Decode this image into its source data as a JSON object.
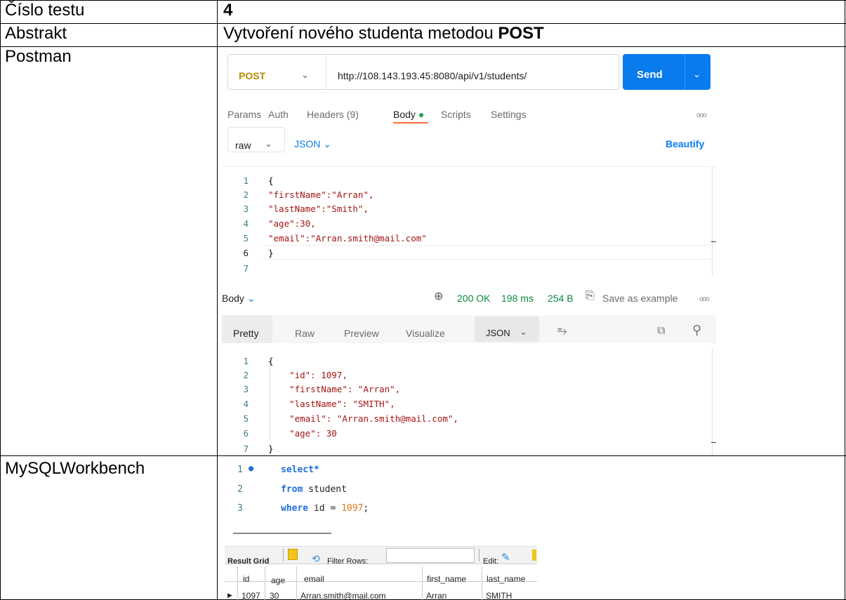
{
  "table": {
    "rows": [
      {
        "label": "Číslo testu",
        "value": "4"
      },
      {
        "label": "Abstrakt",
        "value_prefix": "Vytvoření nového studenta metodou ",
        "value_bold": "POST"
      },
      {
        "label": "Postman"
      },
      {
        "label": "MySQLWorkbench"
      }
    ]
  },
  "postman": {
    "method": "POST",
    "url": "http://108.143.193.45:8080/api/v1/students/",
    "send_label": "Send",
    "tabs": [
      "Params",
      "Auth",
      "Headers (9)",
      "Body",
      "Scripts",
      "Settings"
    ],
    "active_tab": "Body",
    "body_mode": "raw",
    "body_lang": "JSON",
    "beautify_label": "Beautify",
    "request_line_numbers": [
      "1",
      "2",
      "3",
      "4",
      "5",
      "6",
      "7"
    ],
    "request_lines": [
      "{",
      "\"firstName\":\"Arran\",",
      "\"lastName\":\"Smith\",",
      "\"age\":30,",
      "\"email\":\"Arran.smith@mail.com\"",
      "}",
      ""
    ],
    "response": {
      "section_label": "Body",
      "status": "200 OK",
      "time": "198 ms",
      "size": "254 B",
      "save_label": "Save as example",
      "view_tabs": [
        "Pretty",
        "Raw",
        "Preview",
        "Visualize"
      ],
      "active_view": "Pretty",
      "format": "JSON",
      "line_numbers": [
        "1",
        "2",
        "3",
        "4",
        "5",
        "6",
        "7"
      ],
      "lines": [
        "{",
        "    \"id\": 1097,",
        "    \"firstName\": \"Arran\",",
        "    \"lastName\": \"SMITH\",",
        "    \"email\": \"Arran.smith@mail.com\",",
        "    \"age\": 30",
        "}"
      ]
    }
  },
  "workbench": {
    "sql_line_numbers": [
      "1",
      "2",
      "3"
    ],
    "sql": {
      "l1_kw": "select*",
      "l2_kw": "from",
      "l2_rest": " student",
      "l3_kw": "where",
      "l3_rest": " id = ",
      "l3_num": "1097",
      "l3_end": ";"
    },
    "toolbar": {
      "result_grid": "Result Grid",
      "filter_rows": "Filter Rows:",
      "edit": "Edit:"
    },
    "columns": [
      "id",
      "age",
      "email",
      "first_name",
      "last_name"
    ],
    "rows": [
      [
        "1097",
        "30",
        "Arran.smith@mail.com",
        "Arran",
        "SMITH"
      ]
    ]
  }
}
